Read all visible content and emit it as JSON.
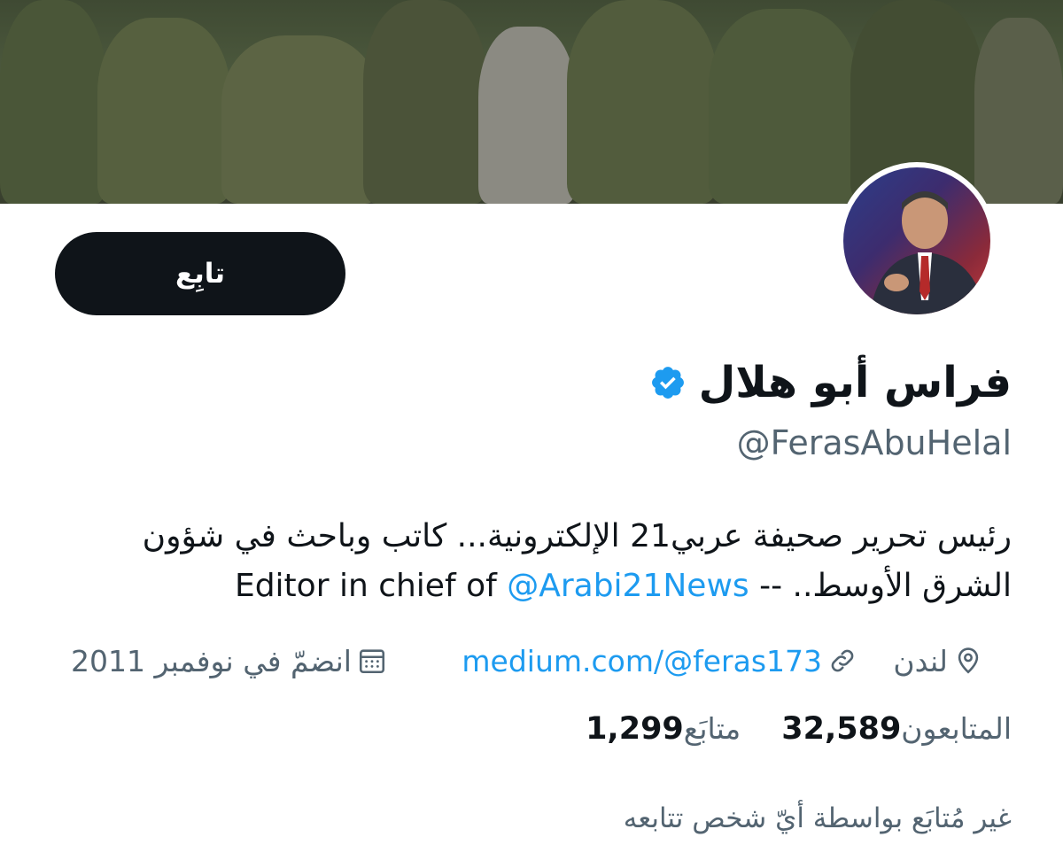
{
  "profile": {
    "follow_label": "تابِع",
    "display_name": "فراس أبو هلال",
    "verified": true,
    "handle": "@FerasAbuHelal",
    "bio_pre": "رئيس تحرير صحيفة عربي21 الإلكترونية... كاتب وباحث في شؤون الشرق الأوسط.. -- Editor in chief of ",
    "bio_mention": "@Arabi21News",
    "location": "لندن",
    "website": "medium.com/@feras173",
    "joined": "انضمّ في نوفمبر 2011",
    "following_count": "1,299",
    "following_label": "متابَع",
    "followers_count": "32,589",
    "followers_label": "المتابعون",
    "not_followed_text": "غير مُتابَع بواسطة أيّ شخص تتابعه"
  },
  "icons": {
    "verified": "verified-badge-icon",
    "location": "location-pin-icon",
    "link": "link-icon",
    "calendar": "calendar-icon"
  },
  "colors": {
    "accent": "#1d9bf0",
    "text": "#0f1419",
    "muted": "#536471",
    "button": "#0f1419"
  }
}
